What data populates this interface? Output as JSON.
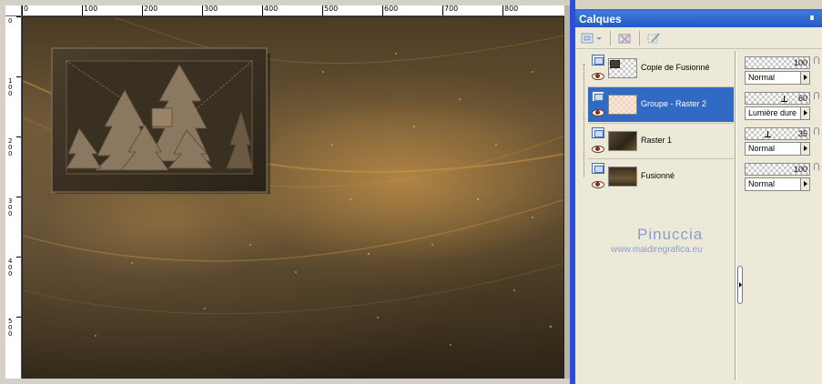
{
  "ruler": {
    "h_labels": [
      "0",
      "100",
      "200",
      "300",
      "400",
      "500",
      "600",
      "700",
      "800"
    ],
    "v_labels": [
      "0",
      "100",
      "200",
      "300",
      "400",
      "500"
    ]
  },
  "palette": {
    "title": "Calques"
  },
  "layers": [
    {
      "name": "Copie de Fusionné",
      "opacity": "100",
      "blend": "Normal",
      "selected": false
    },
    {
      "name": "Groupe - Raster 2",
      "opacity": "60",
      "blend": "Lumière dure",
      "selected": true
    },
    {
      "name": "Raster 1",
      "opacity": "35",
      "blend": "Normal",
      "selected": false
    },
    {
      "name": "Fusionné",
      "opacity": "100",
      "blend": "Normal",
      "selected": false
    }
  ],
  "watermark": {
    "title": "Pinuccia",
    "url": "www.maidiregrafica.eu"
  },
  "colors": {
    "selection": "#316ac5",
    "title_bar": "#2558c8",
    "watermark": "#8a9ec8"
  }
}
